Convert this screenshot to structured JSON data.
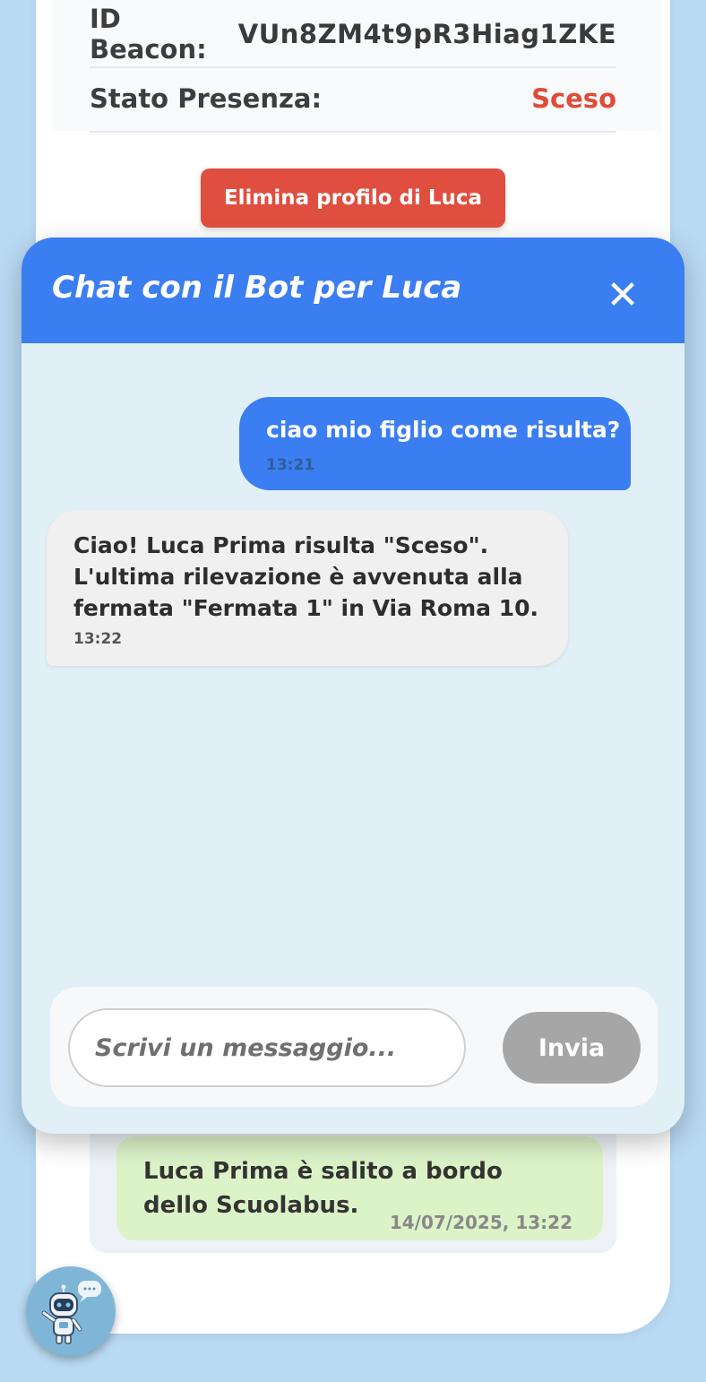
{
  "profile": {
    "beacon_label": "ID Beacon:",
    "beacon_value": "VUn8ZM4t9pR3Hiag1ZKE",
    "status_label": "Stato Presenza:",
    "status_value": "Sceso",
    "delete_button": "Elimina profilo di Luca"
  },
  "chat": {
    "title": "Chat con il Bot per Luca",
    "close_icon": "close-icon",
    "messages": [
      {
        "sender": "user",
        "text": "ciao mio figlio come risulta?",
        "time": "13:21"
      },
      {
        "sender": "bot",
        "text": "Ciao! Luca Prima risulta \"Sceso\". L'ultima rilevazione è avvenuta alla fermata \"Fermata 1\" in Via Roma 10.",
        "time": "13:22"
      }
    ],
    "input_placeholder": "Scrivi un messaggio...",
    "send_button": "Invia"
  },
  "notification": {
    "text": "Luca Prima è salito a bordo dello Scuolabus.",
    "timestamp": "14/07/2025, 13:22"
  },
  "fab": {
    "icon": "robot-assistant-icon"
  },
  "colors": {
    "background": "#b9daf3",
    "accent_blue": "#3a7ef1",
    "danger_red": "#e04e3f",
    "status_red": "#e04b38",
    "notification_green": "#dcf3c8"
  }
}
